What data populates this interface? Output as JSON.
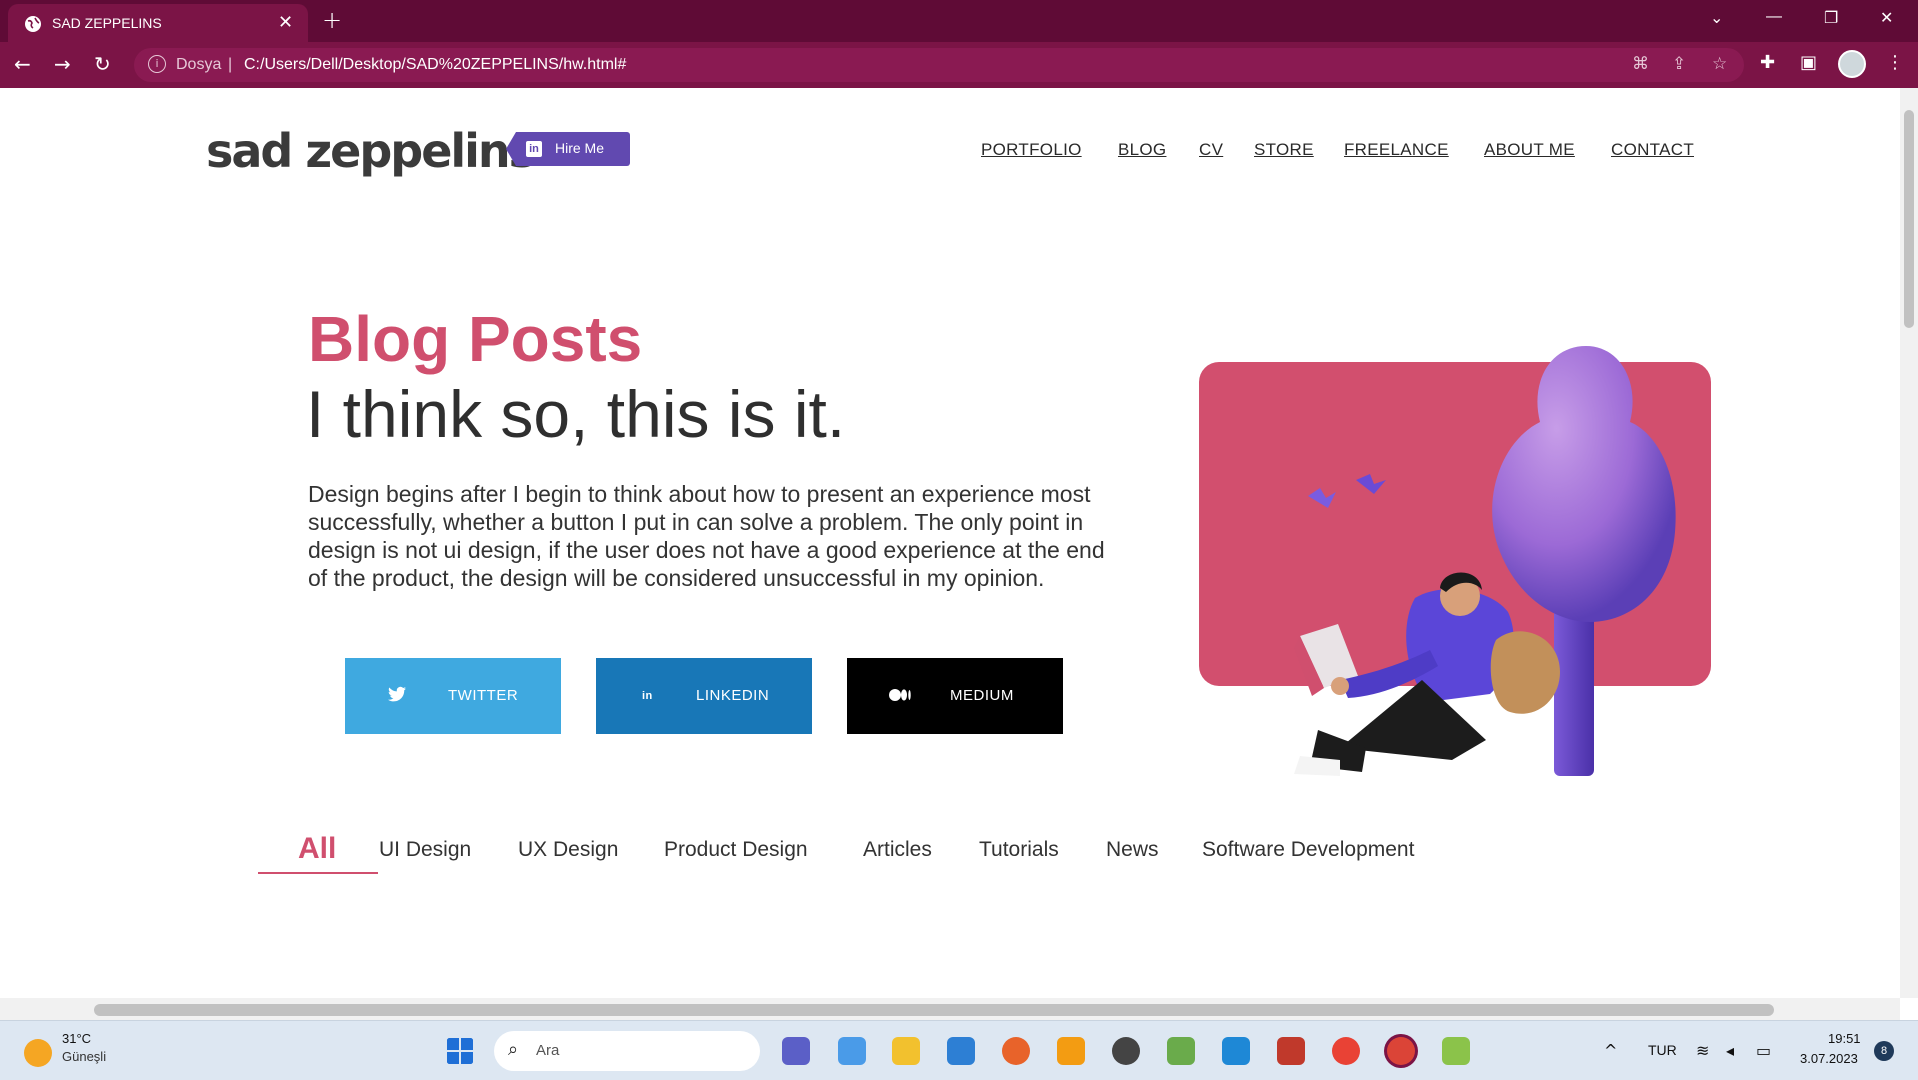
{
  "browser": {
    "tab_title": "SAD ZEPPELINS",
    "url_scheme": "Dosya",
    "url": "C:/Users/Dell/Desktop/SAD%20ZEPPELINS/hw.html#"
  },
  "site": {
    "logo": "sad zeppelins",
    "hire_label": "Hire Me",
    "hire_icon": "in",
    "nav": [
      "PORTFOLIO",
      "BLOG",
      "CV",
      "STORE",
      "FREELANCE",
      "ABOUT ME",
      "CONTACT"
    ]
  },
  "hero": {
    "title": "Blog Posts",
    "headline": "I think so, this is it.",
    "paragraph": "Design begins after I begin to think about how to present an experience most successfully, whether a button I put in can solve a problem. The only point in design is not ui design, if the user does not have a good experience at the end of the product, the design will be considered unsuccessful in my opinion.",
    "buttons": [
      {
        "label": "TWITTER",
        "icon": "twitter-icon",
        "color": "#3fa9e0"
      },
      {
        "label": "LINKEDIN",
        "icon": "linkedin-icon",
        "glyph": "in",
        "color": "#1877b7"
      },
      {
        "label": "MEDIUM",
        "icon": "medium-icon",
        "color": "#000000"
      }
    ]
  },
  "filters": {
    "active": "All",
    "items": [
      "UI Design",
      "UX Design",
      "Product Design",
      "Articles",
      "Tutorials",
      "News",
      "Software Development"
    ]
  },
  "colors": {
    "accent": "#d04f6e",
    "hire": "#6149b0",
    "tabbar": "#5f0b36",
    "toolbar": "#7b1446"
  },
  "taskbar": {
    "temperature": "31°C",
    "weather": "Güneşli",
    "search_placeholder": "Ara",
    "language": "TUR",
    "time": "19:51",
    "date": "3.07.2023",
    "notifications": "8"
  }
}
